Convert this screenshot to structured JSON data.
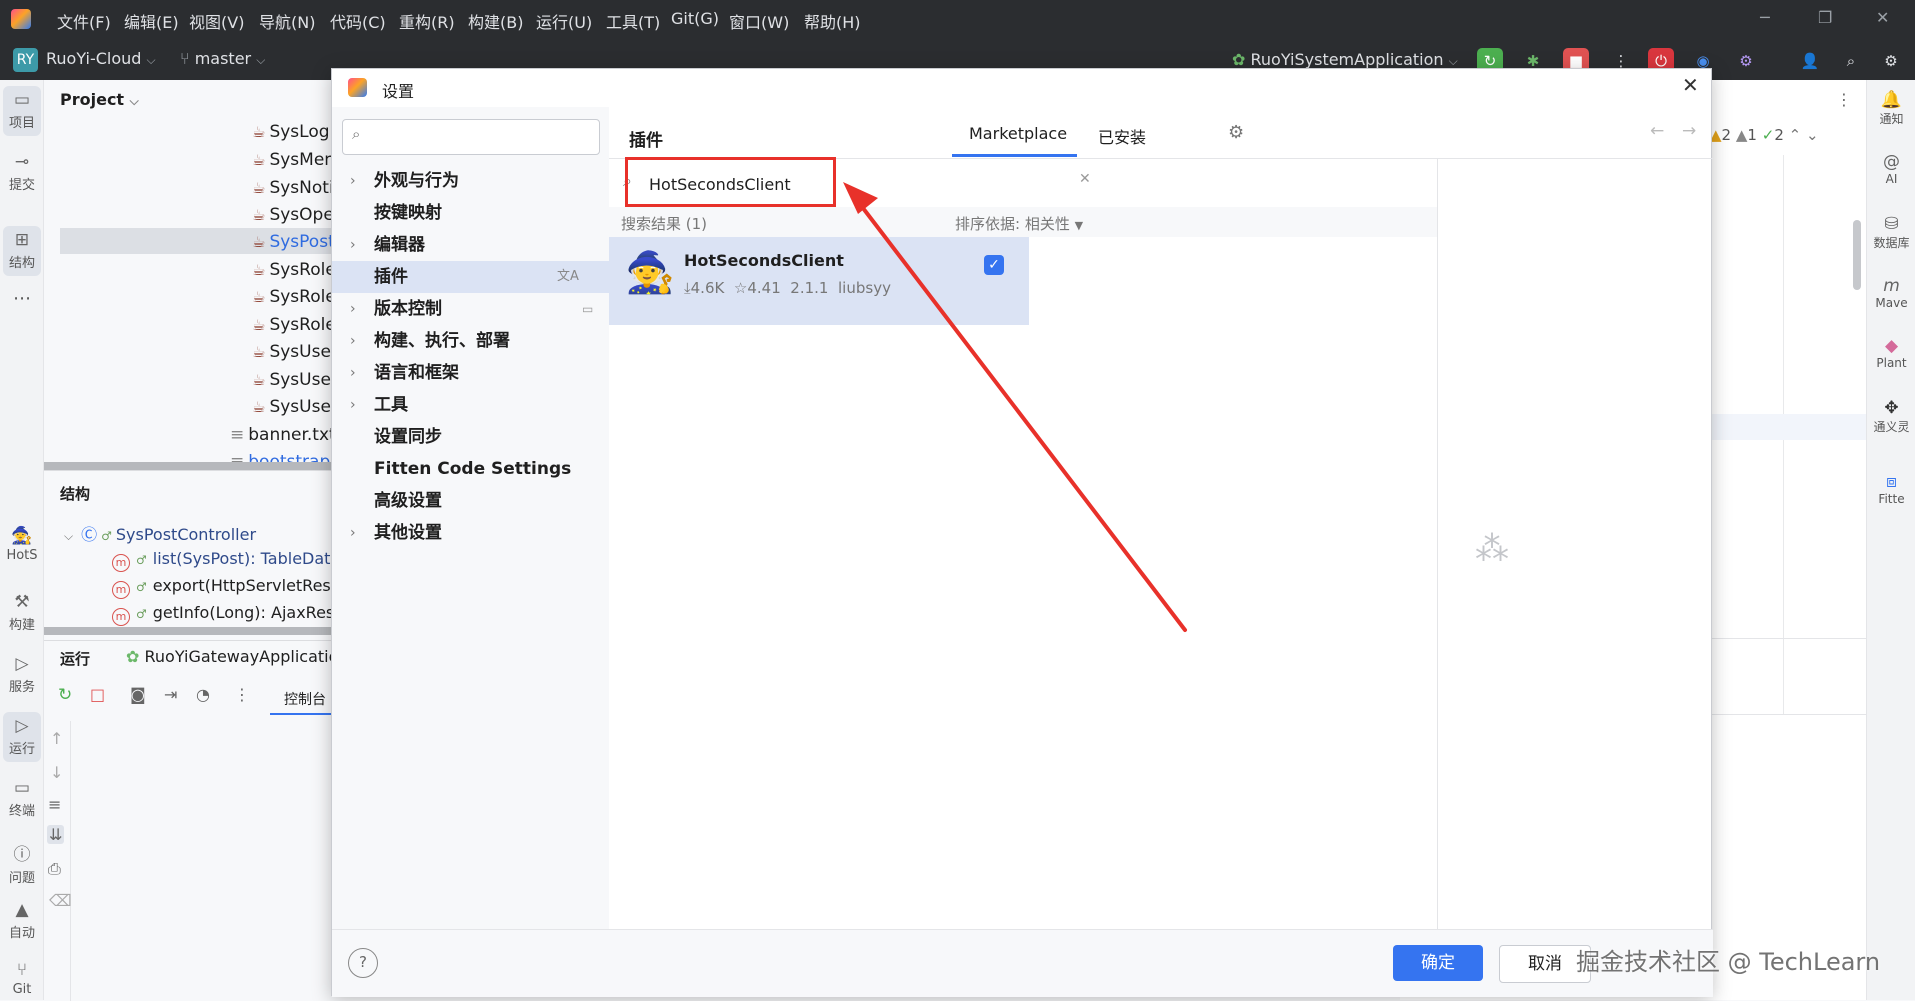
{
  "titlebar": {
    "menus": [
      "文件(F)",
      "编辑(E)",
      "视图(V)",
      "导航(N)",
      "代码(C)",
      "重构(R)",
      "构建(B)",
      "运行(U)",
      "工具(T)",
      "Git(G)",
      "窗口(W)",
      "帮助(H)"
    ]
  },
  "toolbar": {
    "project_badge": "RY",
    "project_name": "RuoYi-Cloud",
    "branch": "master",
    "run_config": "RuoYiSystemApplication"
  },
  "left_strip": {
    "items": [
      "项目",
      "提交",
      "结构",
      "HotS",
      "构建",
      "服务",
      "运行",
      "终端",
      "问题",
      "自动",
      "Git"
    ]
  },
  "project_panel": {
    "title": "Project",
    "files": [
      "SysLogi",
      "SysMen",
      "SysNoti",
      "SysOpe",
      "SysPost",
      "SysRole",
      "SysRole",
      "SysRole",
      "SysUser",
      "SysUser",
      "SysUser"
    ],
    "banner": "banner.txt",
    "bootstrap": "bootstrap."
  },
  "structure_panel": {
    "title": "结构",
    "root": "SysPostController",
    "members": [
      "list(SysPost): TableDataI",
      "export(HttpServletRespo",
      "getInfo(Long): AjaxResu"
    ]
  },
  "run_panel": {
    "title": "运行",
    "config": "RuoYiGatewayApplication",
    "console_tab": "控制台"
  },
  "right_strip": {
    "items": [
      "通知",
      "AI",
      "数据库",
      "Mave",
      "Plant",
      "通义灵",
      "Fitte"
    ]
  },
  "editor": {
    "warnings": "2",
    "weak": "1",
    "checks": "2"
  },
  "dialog": {
    "title": "设置",
    "search_placeholder": "",
    "nav": [
      {
        "label": "外观与行为",
        "expandable": true
      },
      {
        "label": "按键映射",
        "expandable": false
      },
      {
        "label": "编辑器",
        "expandable": true
      },
      {
        "label": "插件",
        "expandable": false,
        "selected": true
      },
      {
        "label": "版本控制",
        "expandable": true
      },
      {
        "label": "构建、执行、部署",
        "expandable": true
      },
      {
        "label": "语言和框架",
        "expandable": true
      },
      {
        "label": "工具",
        "expandable": true
      },
      {
        "label": "设置同步",
        "expandable": false
      },
      {
        "label": "Fitten Code Settings",
        "expandable": false
      },
      {
        "label": "高级设置",
        "expandable": false
      },
      {
        "label": "其他设置",
        "expandable": true
      }
    ],
    "plugins": {
      "heading": "插件",
      "tab_marketplace": "Marketplace",
      "tab_installed": "已安装",
      "search_value": "HotSecondsClient",
      "result_count": "搜索结果 (1)",
      "sort_label": "排序依据: 相关性",
      "result": {
        "name": "HotSecondsClient",
        "downloads": "4.6K",
        "rating": "4.41",
        "version": "2.1.1",
        "author": "liubsyy",
        "checked": true
      }
    },
    "ok_label": "确定",
    "cancel_label": "取消",
    "help_label": "?"
  },
  "watermark": "掘金技术社区 @ TechLearn",
  "colors": {
    "dark_bar": "#2b2d30",
    "accent": "#3574f0",
    "selection": "#dbe3f4",
    "annotation": "#e8312a"
  }
}
